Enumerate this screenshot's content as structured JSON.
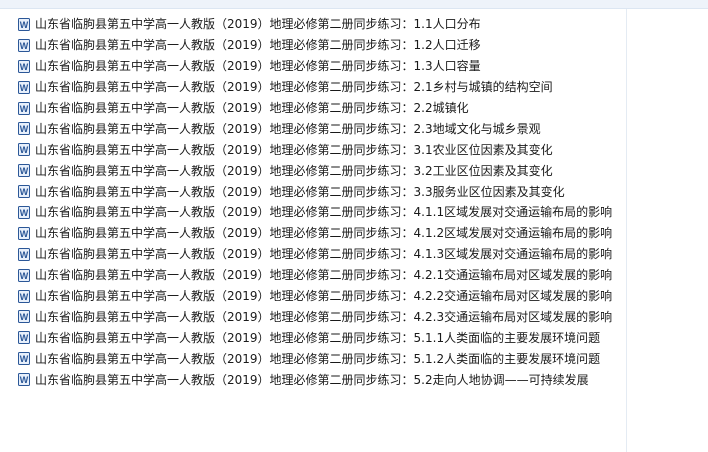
{
  "file_list": {
    "icon": "word-document-icon",
    "icon_colors": {
      "border": "#2b5797",
      "fill": "#e8f0fb",
      "letter": "#2b5797"
    },
    "items": [
      {
        "name": "山东省临朐县第五中学高一人教版（2019）地理必修第二册同步练习：1.1人口分布"
      },
      {
        "name": "山东省临朐县第五中学高一人教版（2019）地理必修第二册同步练习：1.2人口迁移"
      },
      {
        "name": "山东省临朐县第五中学高一人教版（2019）地理必修第二册同步练习：1.3人口容量"
      },
      {
        "name": "山东省临朐县第五中学高一人教版（2019）地理必修第二册同步练习：2.1乡村与城镇的结构空间"
      },
      {
        "name": "山东省临朐县第五中学高一人教版（2019）地理必修第二册同步练习：2.2城镇化"
      },
      {
        "name": "山东省临朐县第五中学高一人教版（2019）地理必修第二册同步练习：2.3地域文化与城乡景观"
      },
      {
        "name": "山东省临朐县第五中学高一人教版（2019）地理必修第二册同步练习：3.1农业区位因素及其变化"
      },
      {
        "name": "山东省临朐县第五中学高一人教版（2019）地理必修第二册同步练习：3.2工业区位因素及其变化"
      },
      {
        "name": "山东省临朐县第五中学高一人教版（2019）地理必修第二册同步练习：3.3服务业区位因素及其变化"
      },
      {
        "name": "山东省临朐县第五中学高一人教版（2019）地理必修第二册同步练习：4.1.1区域发展对交通运输布局的影响"
      },
      {
        "name": "山东省临朐县第五中学高一人教版（2019）地理必修第二册同步练习：4.1.2区域发展对交通运输布局的影响"
      },
      {
        "name": "山东省临朐县第五中学高一人教版（2019）地理必修第二册同步练习：4.1.3区域发展对交通运输布局的影响"
      },
      {
        "name": "山东省临朐县第五中学高一人教版（2019）地理必修第二册同步练习：4.2.1交通运输布局对区域发展的影响"
      },
      {
        "name": "山东省临朐县第五中学高一人教版（2019）地理必修第二册同步练习：4.2.2交通运输布局对区域发展的影响"
      },
      {
        "name": "山东省临朐县第五中学高一人教版（2019）地理必修第二册同步练习：4.2.3交通运输布局对区域发展的影响"
      },
      {
        "name": "山东省临朐县第五中学高一人教版（2019）地理必修第二册同步练习：5.1.1人类面临的主要发展环境问题"
      },
      {
        "name": "山东省临朐县第五中学高一人教版（2019）地理必修第二册同步练习：5.1.2人类面临的主要发展环境问题"
      },
      {
        "name": "山东省临朐县第五中学高一人教版（2019）地理必修第二册同步练习：5.2走向人地协调——可持续发展"
      }
    ]
  }
}
